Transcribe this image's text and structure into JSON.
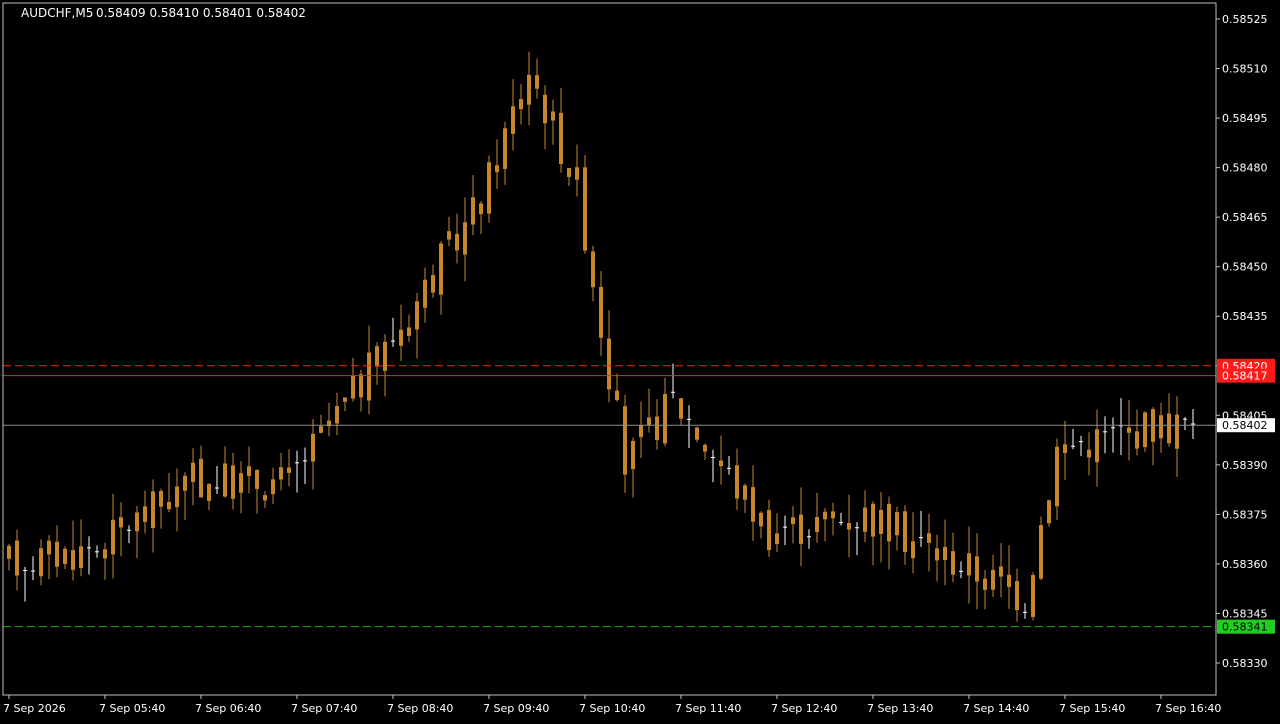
{
  "header": {
    "symbol_tf": "AUDCHF,M5",
    "ohlc": "0.58409 0.58410 0.58401 0.58402"
  },
  "colors": {
    "background": "#000000",
    "frame": "#c0c0c0",
    "axis_text": "#ffffff",
    "candle": "#c8862a",
    "candle_doji": "#ffffff",
    "bid_line": "#8c8c8c",
    "resistance": "#ff2020",
    "support": "#22aa22"
  },
  "chart_data": {
    "type": "candlestick",
    "title": "AUDCHF,M5",
    "ylim": [
      0.58325,
      0.5853
    ],
    "y_ticks": [
      "0.58525",
      "0.58510",
      "0.58495",
      "0.58480",
      "0.58465",
      "0.58450",
      "0.58435",
      "0.58420",
      "0.58405",
      "0.58390",
      "0.58375",
      "0.58360",
      "0.58345",
      "0.58330"
    ],
    "x_ticks": [
      "7 Sep 2026",
      "7 Sep 05:40",
      "7 Sep 06:40",
      "7 Sep 07:40",
      "7 Sep 08:40",
      "7 Sep 09:40",
      "7 Sep 10:40",
      "7 Sep 11:40",
      "7 Sep 12:40",
      "7 Sep 13:40",
      "7 Sep 14:40",
      "7 Sep 15:40",
      "7 Sep 16:40"
    ],
    "levels": [
      {
        "name": "resistance-dashed",
        "price": 0.5842,
        "label": "0.58420",
        "style": "dashed",
        "color": "#ff2020"
      },
      {
        "name": "resistance-solid",
        "price": 0.58417,
        "label": "0.58417",
        "style": "solid",
        "color": "#ff2020"
      },
      {
        "name": "bid-line",
        "price": 0.58402,
        "label": "0.58402",
        "style": "solid",
        "color": "#8c8c8c"
      },
      {
        "name": "support-dashed",
        "price": 0.58341,
        "label": "0.58341",
        "style": "dashed",
        "color": "#22aa22"
      }
    ],
    "key_points": [
      [
        "7 Sep 2026",
        0.5836
      ],
      [
        "7 Sep 05:40",
        0.58365
      ],
      [
        "7 Sep 06:40",
        0.58385
      ],
      [
        "7 Sep 07:40",
        0.58385
      ],
      [
        "7 Sep 08:40",
        0.58425
      ],
      [
        "7 Sep 09:40",
        0.5847
      ],
      [
        "7 Sep 10:10",
        0.5851
      ],
      [
        "7 Sep 10:40",
        0.58475
      ],
      [
        "7 Sep 11:10",
        0.5839
      ],
      [
        "7 Sep 11:40",
        0.5841
      ],
      [
        "7 Sep 12:40",
        0.5837
      ],
      [
        "7 Sep 13:40",
        0.58375
      ],
      [
        "7 Sep 14:40",
        0.5836
      ],
      [
        "7 Sep 15:20",
        0.5835
      ],
      [
        "7 Sep 15:40",
        0.58395
      ],
      [
        "7 Sep 16:40",
        0.58402
      ]
    ]
  }
}
